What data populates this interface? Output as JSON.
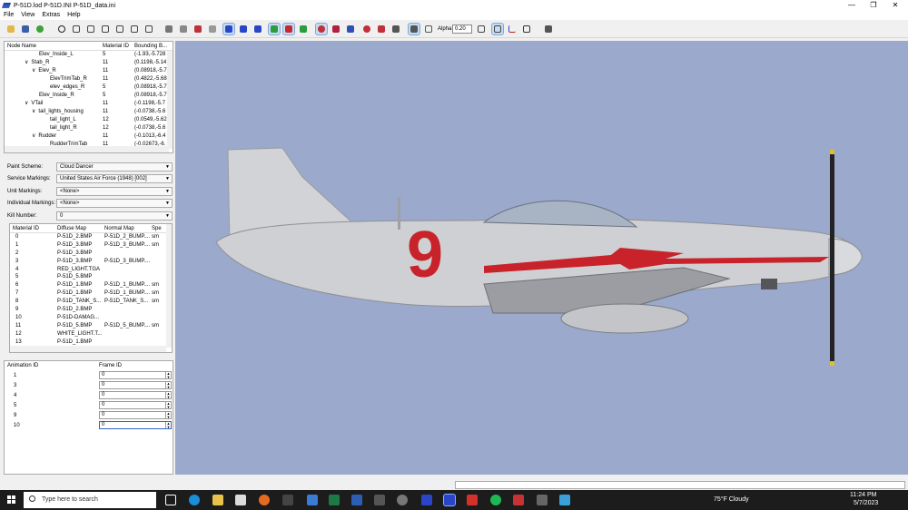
{
  "window": {
    "title": "P-51D.lod  P-51D.INI  P-51D_data.ini",
    "controls": [
      "—",
      "❐",
      "✕"
    ]
  },
  "menu": [
    "File",
    "View",
    "Extras",
    "Help"
  ],
  "toolbar": {
    "alpha_label": "Alpha:",
    "alpha_value": "0.20"
  },
  "tree": {
    "columns": [
      "Node Name",
      "Material ID",
      "Bounding B..."
    ],
    "rows": [
      {
        "name": "Elev_Inside_L",
        "indent": 42,
        "expander": "",
        "mat": "5",
        "bb": "(-1.93,-5.728"
      },
      {
        "name": "Stab_R",
        "indent": 34,
        "expander": "∨",
        "mat": "11",
        "bb": "(0.1198,-5.14"
      },
      {
        "name": "Elev_R",
        "indent": 42,
        "expander": "∨",
        "mat": "11",
        "bb": "(0.08918,-5.7"
      },
      {
        "name": "ElevTrimTab_R",
        "indent": 54,
        "expander": "",
        "mat": "11",
        "bb": "(0.4822,-5.68"
      },
      {
        "name": "elev_edges_R",
        "indent": 54,
        "expander": "",
        "mat": "5",
        "bb": "(0.08918,-5.7"
      },
      {
        "name": "Elev_Inside_R",
        "indent": 42,
        "expander": "",
        "mat": "5",
        "bb": "(0.08918,-5.7"
      },
      {
        "name": "VTail",
        "indent": 34,
        "expander": "∨",
        "mat": "11",
        "bb": "(-0.1198,-5.7"
      },
      {
        "name": "tail_lights_housing",
        "indent": 42,
        "expander": "∨",
        "mat": "11",
        "bb": "(-0.0738,-5.6"
      },
      {
        "name": "tail_light_L",
        "indent": 54,
        "expander": "",
        "mat": "12",
        "bb": "(0.0549,-5.62"
      },
      {
        "name": "tail_light_R",
        "indent": 54,
        "expander": "",
        "mat": "12",
        "bb": "(-0.0738,-5.6"
      },
      {
        "name": "Rudder",
        "indent": 42,
        "expander": "∨",
        "mat": "11",
        "bb": "(-0.1013,-6.4"
      },
      {
        "name": "RudderTrimTab",
        "indent": 54,
        "expander": "",
        "mat": "11",
        "bb": "(-0.02673,-6."
      }
    ]
  },
  "schemes": [
    {
      "label": "Paint Scheme:",
      "value": "Cloud Dancer"
    },
    {
      "label": "Service Markings:",
      "value": "United States Air Force (1948) [002]"
    },
    {
      "label": "Unit Markings:",
      "value": "<None>"
    },
    {
      "label": "Individual Markings:",
      "value": "<None>"
    },
    {
      "label": "Kill Number:",
      "value": "0"
    }
  ],
  "materials": {
    "columns": [
      "Material ID",
      "Diffuse Map",
      "Normal Map",
      "Spe"
    ],
    "rows": [
      {
        "id": "0",
        "diffuse": "P-51D_2.BMP",
        "normal": "P-51D_2_BUMP....",
        "spec": "sm"
      },
      {
        "id": "1",
        "diffuse": "P-51D_3.BMP",
        "normal": "P-51D_3_BUMP....",
        "spec": "sm"
      },
      {
        "id": "2",
        "diffuse": "P-51D_3.BMP",
        "normal": "",
        "spec": ""
      },
      {
        "id": "3",
        "diffuse": "P-51D_3.BMP",
        "normal": "P-51D_3_BUMP....",
        "spec": ""
      },
      {
        "id": "4",
        "diffuse": "RED_LIGHT.TGA",
        "normal": "",
        "spec": ""
      },
      {
        "id": "5",
        "diffuse": "P-51D_5.BMP",
        "normal": "",
        "spec": ""
      },
      {
        "id": "6",
        "diffuse": "P-51D_1.BMP",
        "normal": "P-51D_1_BUMP....",
        "spec": "sm"
      },
      {
        "id": "7",
        "diffuse": "P-51D_1.BMP",
        "normal": "P-51D_1_BUMP....",
        "spec": "sm"
      },
      {
        "id": "8",
        "diffuse": "P-51D_TANK_S...",
        "normal": "P-51D_TANK_S...",
        "spec": "sm"
      },
      {
        "id": "9",
        "diffuse": "P-51D_2.BMP",
        "normal": "",
        "spec": ""
      },
      {
        "id": "10",
        "diffuse": "P-51D-DAMAG...",
        "normal": "",
        "spec": ""
      },
      {
        "id": "11",
        "diffuse": "P-51D_5.BMP",
        "normal": "P-51D_5_BUMP....",
        "spec": "sm"
      },
      {
        "id": "12",
        "diffuse": "WHITE_LIGHT.T...",
        "normal": "",
        "spec": ""
      },
      {
        "id": "13",
        "diffuse": "P-51D_1.BMP",
        "normal": "",
        "spec": ""
      }
    ]
  },
  "animation": {
    "columns": [
      "Animation ID",
      "Frame ID"
    ],
    "rows": [
      {
        "id": "1",
        "frame": "0"
      },
      {
        "id": "3",
        "frame": "0"
      },
      {
        "id": "4",
        "frame": "0"
      },
      {
        "id": "5",
        "frame": "0"
      },
      {
        "id": "9",
        "frame": "0"
      },
      {
        "id": "10",
        "frame": "0"
      }
    ]
  },
  "aircraft": {
    "number": "9",
    "color_body": "#c9cace",
    "color_marking": "#c8232b",
    "background": "#9aa9cc"
  },
  "taskbar": {
    "search_placeholder": "Type here to search",
    "weather": "75°F  Cloudy",
    "time": "11:24 PM",
    "date": "5/7/2023"
  }
}
